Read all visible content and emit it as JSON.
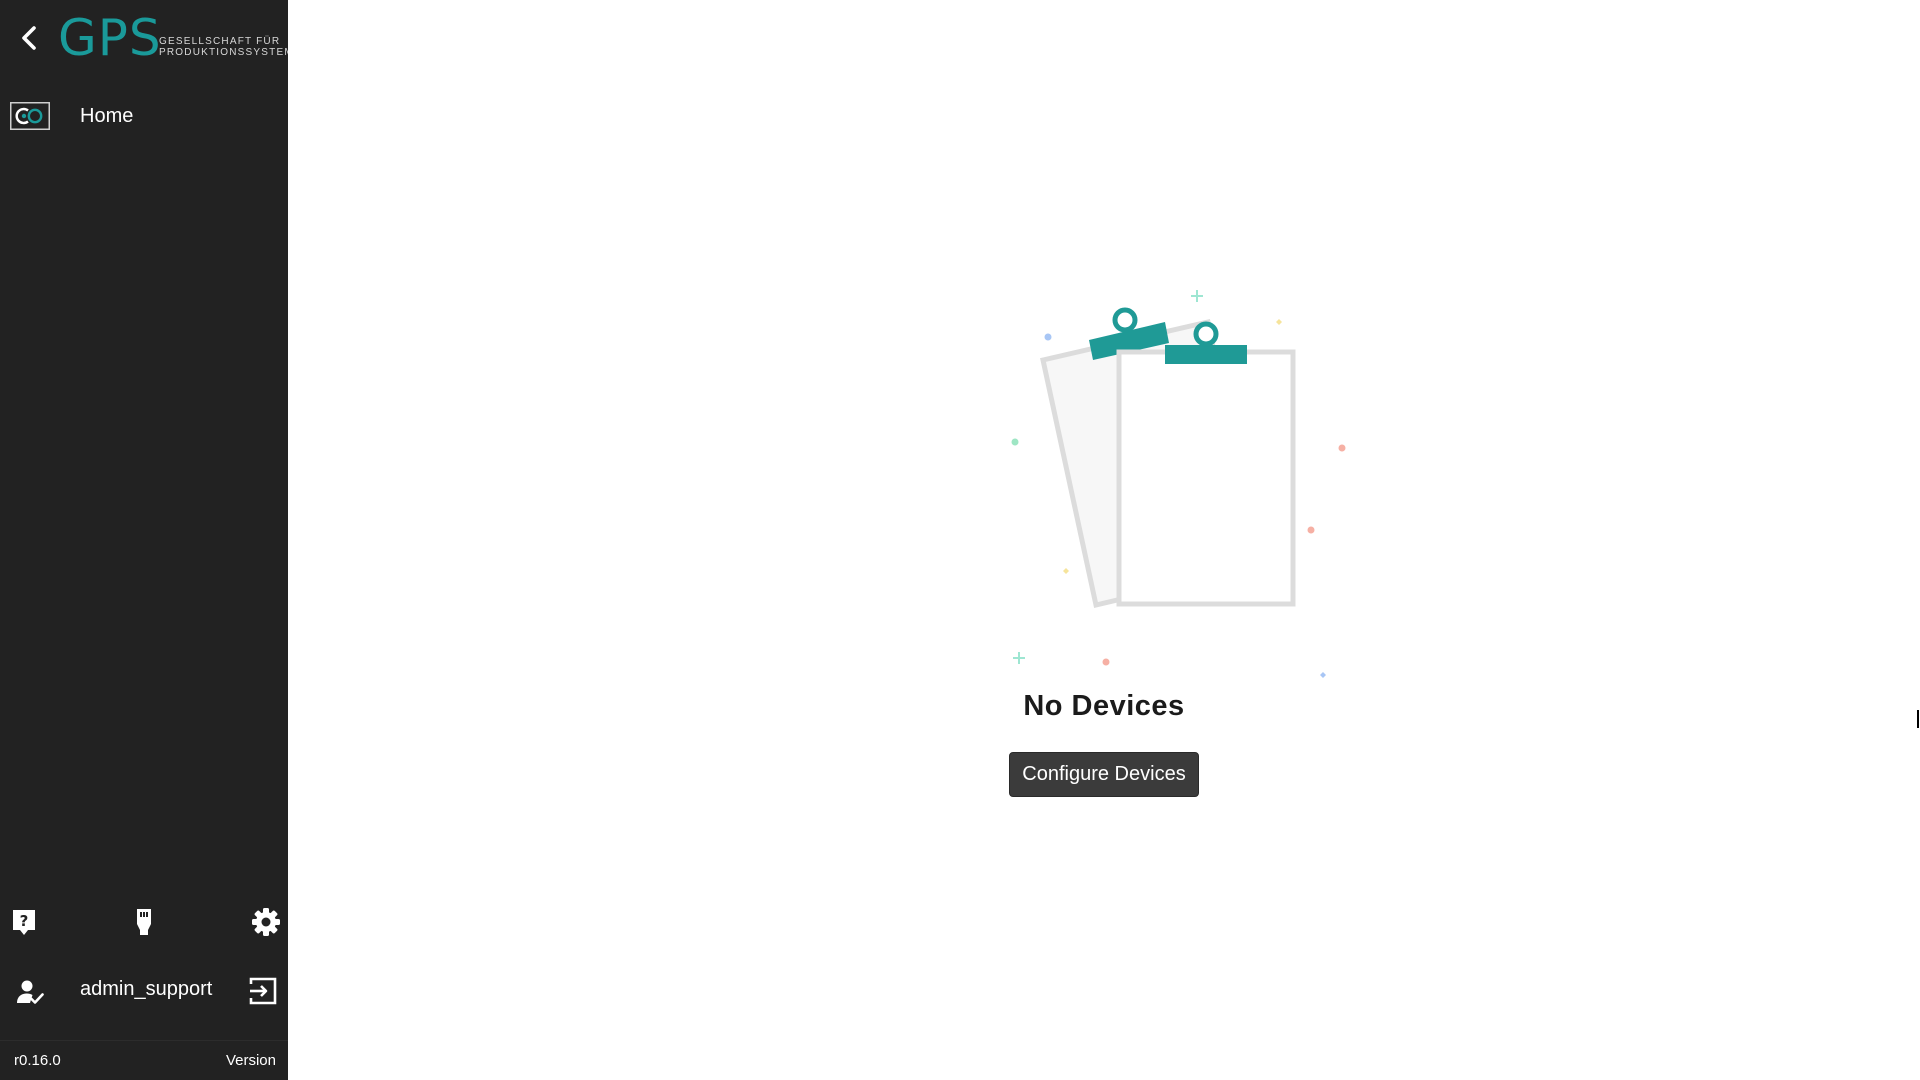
{
  "colors": {
    "sidebar_bg": "#222222",
    "brand_teal": "#1a9a9a",
    "button_bg": "#3b3b3b"
  },
  "logo": {
    "mark": "GPS",
    "line1": "GESELLSCHAFT FÜR",
    "line2": "PRODUKTIONSSYSTEME"
  },
  "sidebar": {
    "back_icon": "chevron-left-icon",
    "nav_items": [
      {
        "label": "Home",
        "icon": "co-logo-icon"
      }
    ],
    "tools": [
      {
        "icon": "help-icon"
      },
      {
        "icon": "network-plug-icon"
      },
      {
        "icon": "gear-icon"
      }
    ],
    "user": {
      "name": "admin_support",
      "icon": "user-check-icon",
      "logout_icon": "logout-icon"
    },
    "footer": {
      "version_number": "r0.16.0",
      "version_label": "Version"
    }
  },
  "main": {
    "empty_state": {
      "illustration": "clipboards-illustration",
      "title": "No Devices",
      "button_label": "Configure Devices"
    }
  }
}
